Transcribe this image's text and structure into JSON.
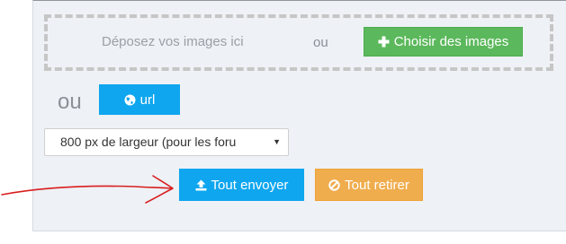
{
  "upload": {
    "drop_label": "Déposez vos images ici",
    "or_inline": "ou",
    "choose_label": "Choisir des images",
    "or_url": "ou",
    "url_label": "url",
    "resize_selected": "800 px de largeur (pour les foru",
    "send_all_label": "Tout envoyer",
    "remove_all_label": "Tout retirer"
  },
  "colors": {
    "green": "#5cb85c",
    "blue": "#0fa6ef",
    "orange": "#f0ad4e",
    "annotation_red": "#d81e1e"
  },
  "icons": {
    "choose": "plus-icon",
    "url": "globe-icon",
    "send": "upload-icon",
    "remove": "ban-icon",
    "select": "chevron-down-icon",
    "annotation": "hand-drawn-arrow"
  }
}
